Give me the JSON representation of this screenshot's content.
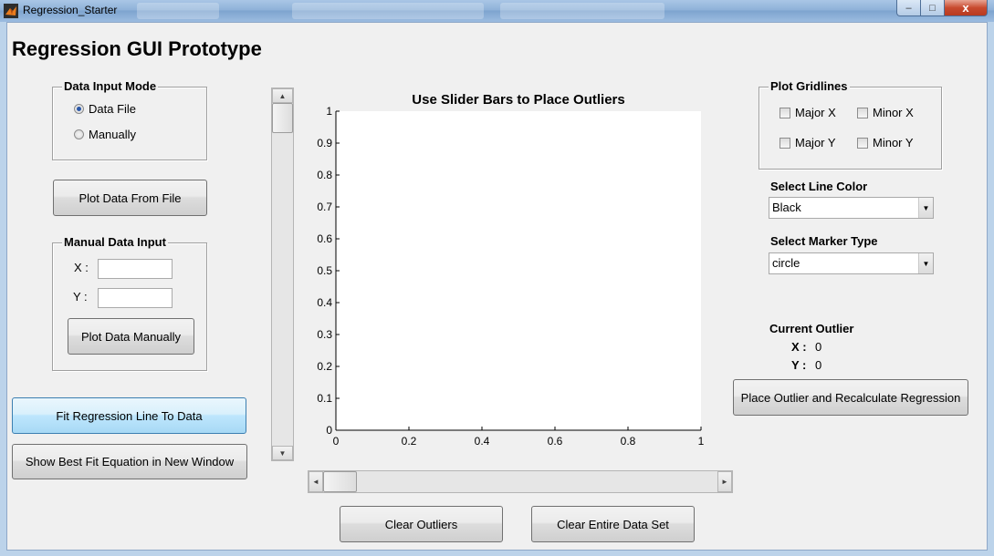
{
  "window": {
    "title": "Regression_Starter",
    "close_glyph": "x",
    "min_glyph": "–",
    "max_glyph": "□"
  },
  "heading": "Regression GUI Prototype",
  "data_input_mode": {
    "title": "Data Input Mode",
    "options": [
      {
        "label": "Data File",
        "selected": true
      },
      {
        "label": "Manually",
        "selected": false
      }
    ]
  },
  "plot_from_file_button": "Plot Data From File",
  "manual_input": {
    "title": "Manual Data Input",
    "x_label": "X :",
    "y_label": "Y :",
    "x_value": "",
    "y_value": "",
    "plot_button": "Plot Data Manually"
  },
  "fit_button": "Fit Regression Line To Data",
  "show_equation_button": "Show Best Fit Equation in New Window",
  "plot": {
    "title": "Use Slider Bars to Place Outliers",
    "y_ticks": [
      "0",
      "0.1",
      "0.2",
      "0.3",
      "0.4",
      "0.5",
      "0.6",
      "0.7",
      "0.8",
      "0.9",
      "1"
    ],
    "x_ticks": [
      "0",
      "0.2",
      "0.4",
      "0.6",
      "0.8",
      "1"
    ]
  },
  "vertical_slider": {
    "value": 1.0,
    "up_glyph": "▲",
    "down_glyph": "▼"
  },
  "horizontal_slider": {
    "value": 0.0,
    "left_glyph": "◄",
    "right_glyph": "►"
  },
  "clear_outliers_button": "Clear Outliers",
  "clear_all_button": "Clear Entire Data Set",
  "gridlines": {
    "title": "Plot Gridlines",
    "major_x": "Major X",
    "minor_x": "Minor X",
    "major_y": "Major Y",
    "minor_y": "Minor Y"
  },
  "line_color": {
    "label": "Select Line Color",
    "value": "Black"
  },
  "marker_type": {
    "label": "Select Marker Type",
    "value": "circle"
  },
  "current_outlier": {
    "title": "Current Outlier",
    "x_label": "X :",
    "x_value": "0",
    "y_label": "Y :",
    "y_value": "0"
  },
  "place_outlier_button": "Place Outlier and Recalculate Regression",
  "colors": {
    "titlebar": "#8fb2d9",
    "panel": "#f0f0f0",
    "hot_button": "#bee6fd"
  }
}
